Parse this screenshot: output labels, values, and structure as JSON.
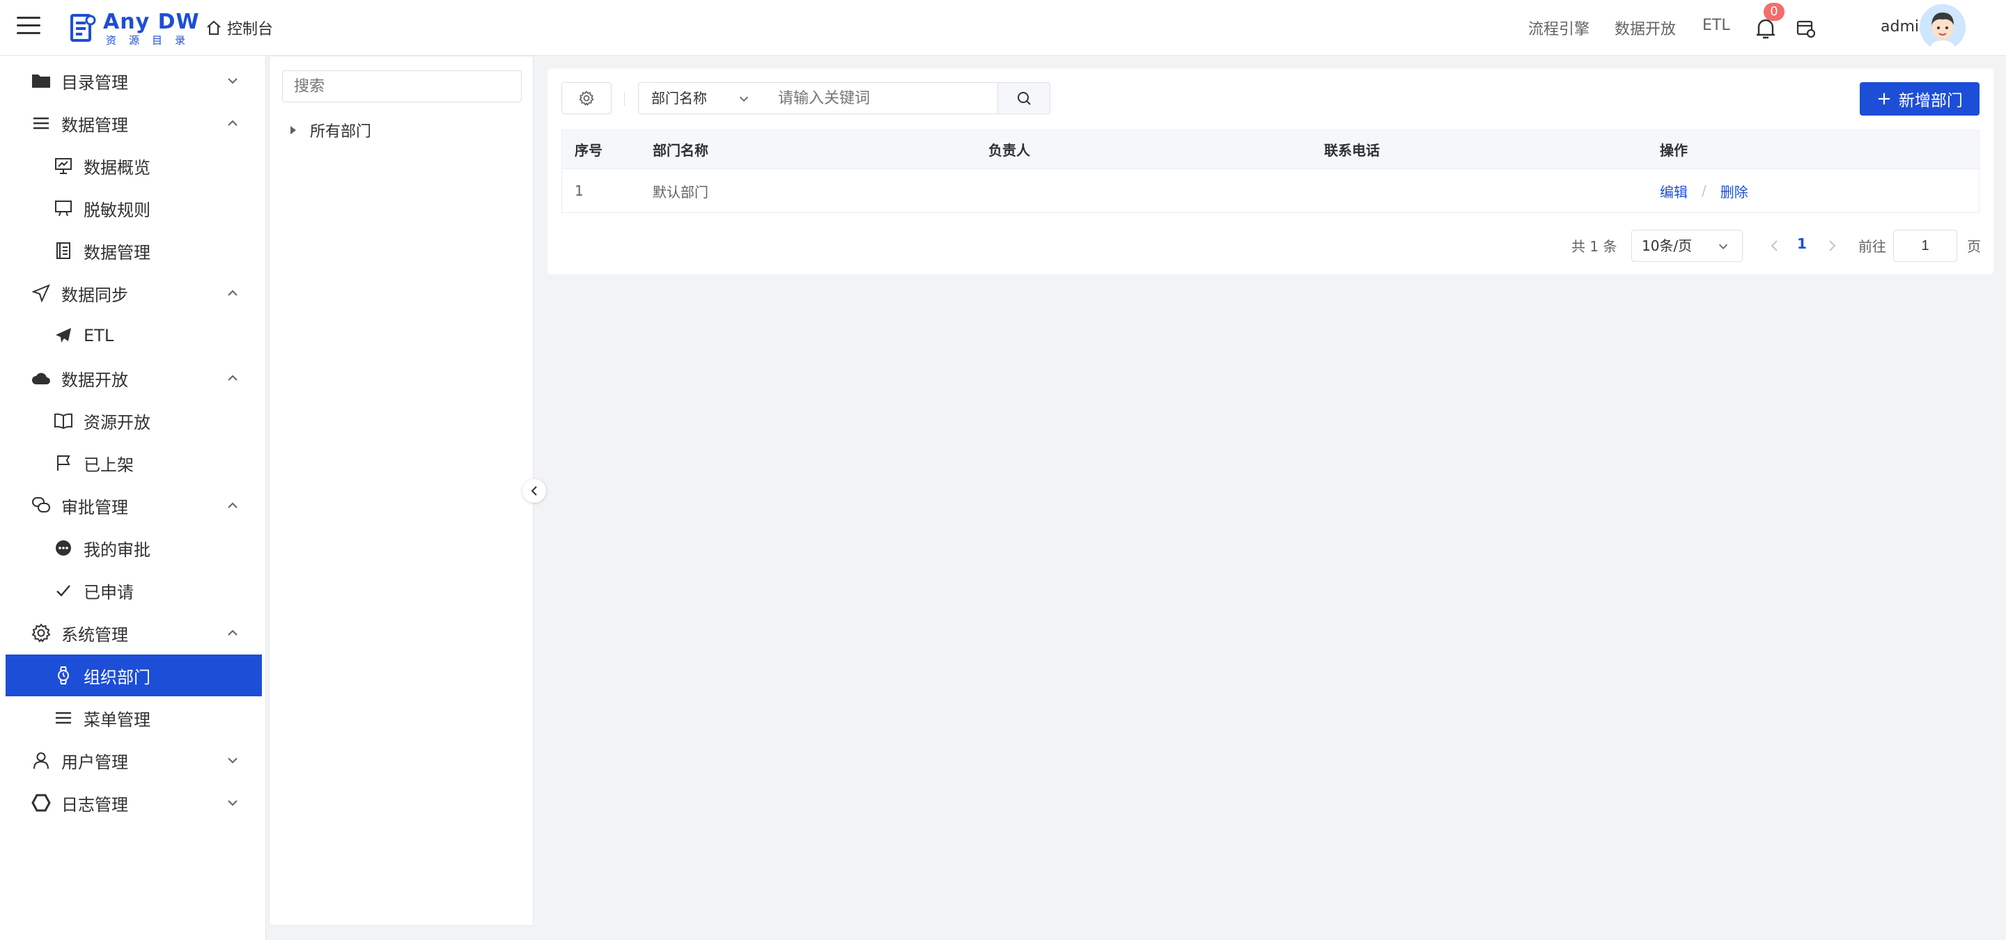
{
  "header": {
    "logo_title": "Any DW",
    "logo_subtitle": "资源目录",
    "console_label": "控制台",
    "nav": [
      "流程引擎",
      "数据开放",
      "ETL"
    ],
    "notification_count": "0",
    "user_name": "admin"
  },
  "sidebar": {
    "items": [
      {
        "label": "目录管理",
        "icon": "folder-icon",
        "level": 1,
        "expanded": false
      },
      {
        "label": "数据管理",
        "icon": "list-icon",
        "level": 1,
        "expanded": true
      },
      {
        "label": "数据概览",
        "icon": "presentation-chart-icon",
        "level": 2
      },
      {
        "label": "脱敏规则",
        "icon": "monitor-icon",
        "level": 2
      },
      {
        "label": "数据管理",
        "icon": "document-icon",
        "level": 2
      },
      {
        "label": "数据同步",
        "icon": "send-icon",
        "level": 1,
        "expanded": true
      },
      {
        "label": "ETL",
        "icon": "paper-plane-icon",
        "level": 2
      },
      {
        "label": "数据开放",
        "icon": "cloud-icon",
        "level": 1,
        "expanded": true
      },
      {
        "label": "资源开放",
        "icon": "book-icon",
        "level": 2
      },
      {
        "label": "已上架",
        "icon": "flag-icon",
        "level": 2
      },
      {
        "label": "审批管理",
        "icon": "chat-bubbles-icon",
        "level": 1,
        "expanded": true
      },
      {
        "label": "我的审批",
        "icon": "chat-dots-icon",
        "level": 2
      },
      {
        "label": "已申请",
        "icon": "check-icon",
        "level": 2
      },
      {
        "label": "系统管理",
        "icon": "gear-icon",
        "level": 1,
        "expanded": true
      },
      {
        "label": "组织部门",
        "icon": "watch-icon",
        "level": 2,
        "active": true
      },
      {
        "label": "菜单管理",
        "icon": "menu-icon",
        "level": 2
      },
      {
        "label": "用户管理",
        "icon": "user-icon",
        "level": 1,
        "expanded": false
      },
      {
        "label": "日志管理",
        "icon": "hexagon-icon",
        "level": 1,
        "expanded": false
      }
    ]
  },
  "tree": {
    "search_placeholder": "搜索",
    "root_label": "所有部门"
  },
  "toolbar": {
    "search_field": "部门名称",
    "search_placeholder": "请输入关键词",
    "add_label": "新增部门"
  },
  "table": {
    "headers": [
      "序号",
      "部门名称",
      "负责人",
      "联系电话",
      "操作"
    ],
    "rows": [
      {
        "index": "1",
        "name": "默认部门",
        "owner": "",
        "phone": "",
        "edit": "编辑",
        "sep": "/",
        "delete": "删除"
      }
    ]
  },
  "pagination": {
    "total_text": "共 1 条",
    "page_size": "10条/页",
    "current_page": "1",
    "goto_label": "前往",
    "goto_value": "1",
    "goto_unit": "页"
  },
  "colors": {
    "primary": "#1d4ed8",
    "badge": "#f56c6c"
  }
}
